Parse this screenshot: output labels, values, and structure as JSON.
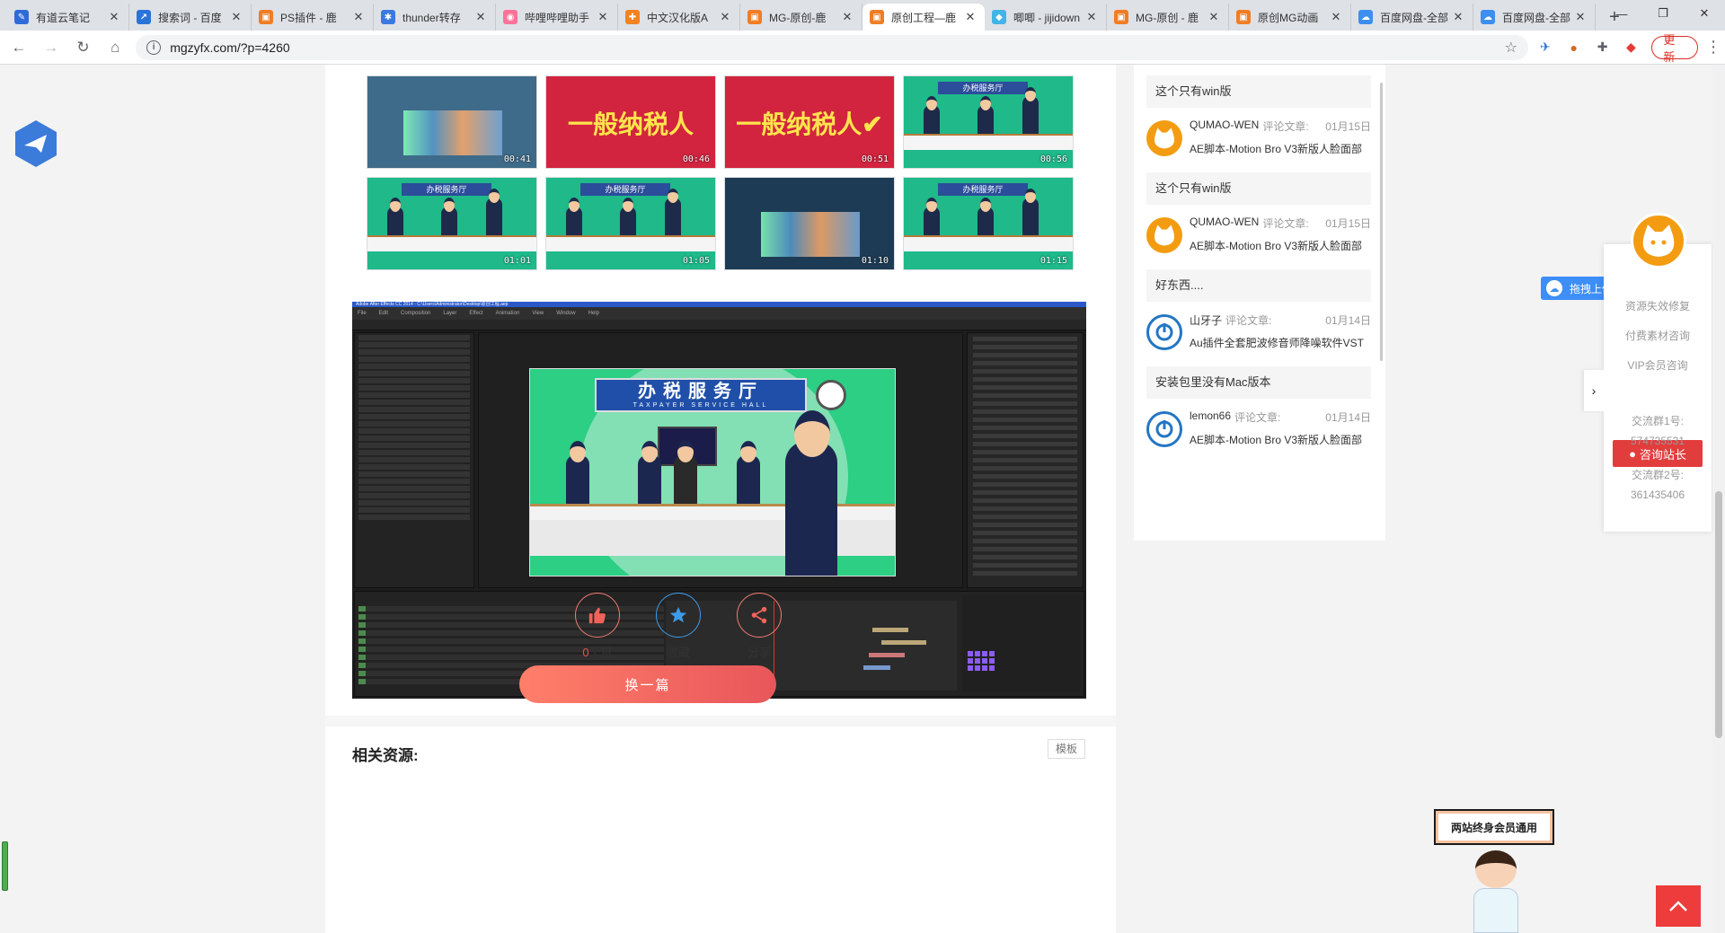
{
  "browser": {
    "tabs": [
      {
        "title": "有道云笔记",
        "color": "#2f6bd8",
        "glyph": "✎"
      },
      {
        "title": "搜索词 - 百度",
        "color": "#2a74d9",
        "glyph": "↗"
      },
      {
        "title": "PS插件 - 鹿",
        "color": "#f07d25",
        "glyph": "▣"
      },
      {
        "title": "thunder转存",
        "color": "#3a7ae0",
        "glyph": "✱"
      },
      {
        "title": "哔哩哔哩助手",
        "color": "#fb7299",
        "glyph": "◉"
      },
      {
        "title": "中文汉化版A",
        "color": "#f58220",
        "glyph": "✚"
      },
      {
        "title": "MG-原创-鹿",
        "color": "#f07d25",
        "glyph": "▣"
      },
      {
        "title": "原创工程—鹿",
        "color": "#f07d25",
        "glyph": "▣",
        "active": true
      },
      {
        "title": "唧唧 - jijidown",
        "color": "#41b5e6",
        "glyph": "◆"
      },
      {
        "title": "MG-原创 - 鹿",
        "color": "#f07d25",
        "glyph": "▣"
      },
      {
        "title": "原创MG动画",
        "color": "#f07d25",
        "glyph": "▣"
      },
      {
        "title": "百度网盘-全部",
        "color": "#3c8ef0",
        "glyph": "☁"
      },
      {
        "title": "百度网盘-全部",
        "color": "#3c8ef0",
        "glyph": "☁"
      }
    ],
    "new_tab": "+",
    "window_controls": [
      "—",
      "❐",
      "✕"
    ],
    "url": "mgzyfx.com/?p=4260",
    "update_label": "更新"
  },
  "thumbs": [
    {
      "dur": "00:41",
      "bg": "#3f6b8a",
      "style": "city"
    },
    {
      "dur": "00:46",
      "bg": "#d2243f",
      "style": "text",
      "text": "一般纳税人"
    },
    {
      "dur": "00:51",
      "bg": "#d2243f",
      "style": "text",
      "text": "一般纳税人✔"
    },
    {
      "dur": "00:56",
      "bg": "#1fb98a",
      "style": "hall"
    },
    {
      "dur": "01:01",
      "bg": "#1fb98a",
      "style": "hall"
    },
    {
      "dur": "01:05",
      "bg": "#1fb98a",
      "style": "hall"
    },
    {
      "dur": "01:10",
      "bg": "#1e3b55",
      "style": "city"
    },
    {
      "dur": "01:15",
      "bg": "#1fb98a",
      "style": "hall"
    }
  ],
  "hall_sign": "办税服务厅",
  "ae": {
    "window_title": "Adobe After Effects CC 2014 - C:\\Users\\Administrator\\Desktop\\原创工程.aep",
    "menu": [
      "File",
      "Edit",
      "Composition",
      "Layer",
      "Effect",
      "Animation",
      "View",
      "Window",
      "Help"
    ],
    "sign_cn": "办税服务厅",
    "sign_en": "TAXPAYER SERVICE HALL"
  },
  "actions": {
    "like_count": "0",
    "like_label": "个赞",
    "favorite_label": "收藏",
    "share_label": "分享"
  },
  "next_label": "换一篇",
  "related": {
    "title": "相关资源:",
    "tag": "模板"
  },
  "comments": [
    {
      "quote": "这个只有win版",
      "user": "QUMAO-WEN",
      "label": "评论文章:",
      "date": "01月15日",
      "article": "AE脚本-Motion Bro V3新版人脸面部",
      "avatar": "orange"
    },
    {
      "quote": "这个只有win版",
      "user": "QUMAO-WEN",
      "label": "评论文章:",
      "date": "01月15日",
      "article": "AE脚本-Motion Bro V3新版人脸面部",
      "avatar": "orange"
    },
    {
      "quote": "好东西....",
      "user": "山牙子",
      "label": "评论文章:",
      "date": "01月14日",
      "article": "Au插件全套肥波修音师降噪软件VST",
      "avatar": "blue"
    },
    {
      "quote": "安装包里没有Mac版本",
      "user": "lemon66",
      "label": "评论文章:",
      "date": "01月14日",
      "article": "AE脚本-Motion Bro V3新版人脸面部",
      "avatar": "blue"
    }
  ],
  "float_panel": {
    "items": [
      "资源失效修复",
      "付费素材咨询",
      "VIP会员咨询"
    ],
    "consult_button": "咨询站长",
    "group1_label": "交流群1号:",
    "group1_number": "574735531",
    "group2_label": "交流群2号:",
    "group2_number": "361435406"
  },
  "baidu_chip": "拖拽上传",
  "mascot_sign": "两站终身会员通用"
}
